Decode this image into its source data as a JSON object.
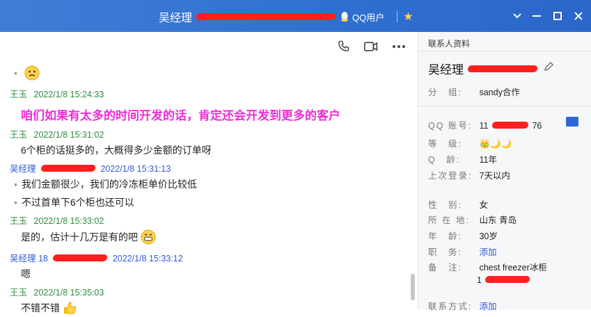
{
  "window": {
    "title_name": "吴经理",
    "qq_user": "QQ用户",
    "colors": {
      "titlebar": "#2f6fd0",
      "green_name": "#2e8a3e",
      "blue_name": "#2d5bd8",
      "highlight": "#f12bd6"
    }
  },
  "chat": {
    "messages": [
      {
        "sender": "",
        "time": "",
        "text": "",
        "emoji": "worried-face-icon"
      },
      {
        "sender": "王玉",
        "time": "2022/1/8 15:24:33",
        "text": ""
      },
      {
        "sender": "",
        "time": "",
        "text": "咱们如果有太多的时间开发的话，肯定还会开发到更多的客户",
        "style": "highlight"
      },
      {
        "sender": "王玉",
        "time": "2022/1/8 15:31:02",
        "text": "6个柜的话挺多的，大概得多少金额的订单呀"
      },
      {
        "sender": "吴经理",
        "time": "2022/1/8 15:31:13",
        "text": "我们金额很少，我们的冷冻柜单价比较低"
      },
      {
        "sender": "",
        "time": "",
        "text": "不过首单下6个柜也还可以"
      },
      {
        "sender": "王玉",
        "time": "2022/1/8 15:33:02",
        "text": "是的，估计十几万是有的吧",
        "emoji": "grin-face-icon"
      },
      {
        "sender": "吴经理 18",
        "time": "2022/1/8 15:33:12",
        "text": "嗯"
      },
      {
        "sender": "王玉",
        "time": "2022/1/8 15:35:03",
        "text": "不错不错",
        "emoji": "thumbs-up-icon"
      }
    ]
  },
  "profile": {
    "tab": "联系人资料",
    "name": "吴经理",
    "rows": [
      {
        "label": "分　组:",
        "value": "sandy合作"
      },
      {
        "label": "QQ 账号:",
        "value": "11",
        "value_suffix": "76"
      },
      {
        "label": "等　级:",
        "value": "👑🌙🌙"
      },
      {
        "label": "Q　龄:",
        "value": "11年"
      },
      {
        "label": "上次登录:",
        "value": "7天以内"
      },
      {
        "label": "性　别:",
        "value": "女"
      },
      {
        "label": "所 在 地:",
        "value": "山东 青岛"
      },
      {
        "label": "年　龄:",
        "value": "30岁"
      },
      {
        "label": "职　务:",
        "value": "添加",
        "link": true
      },
      {
        "label": "备　注:",
        "value": "chest freezer冰柜",
        "value2": "1"
      },
      {
        "label": "联系方式:",
        "value": "添加",
        "link": true
      }
    ]
  }
}
